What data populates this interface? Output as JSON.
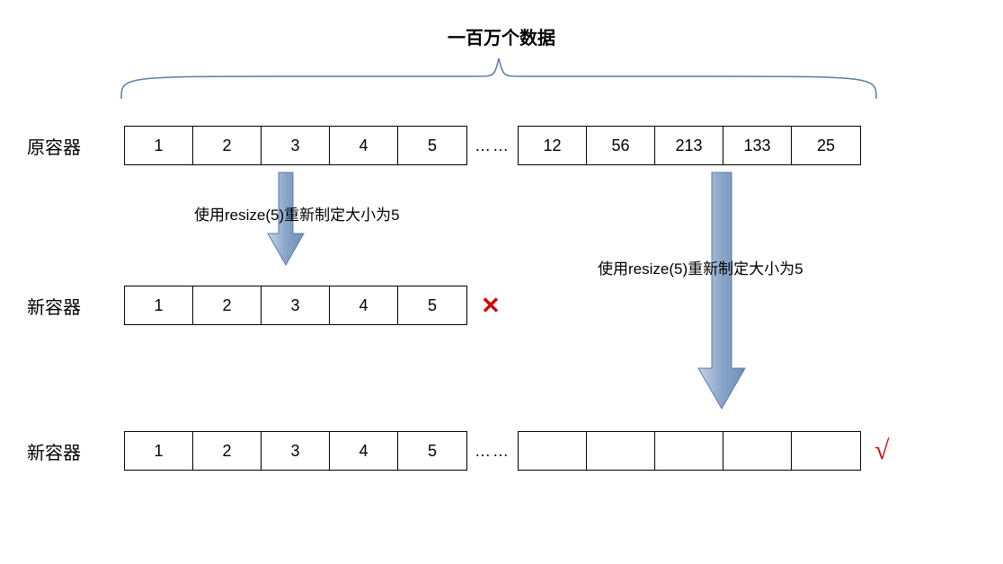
{
  "title": "一百万个数据",
  "labels": {
    "original": "原容器",
    "new": "新容器"
  },
  "rows": {
    "original_left": [
      "1",
      "2",
      "3",
      "4",
      "5"
    ],
    "original_right": [
      "12",
      "56",
      "213",
      "133",
      "25"
    ],
    "wrong_new": [
      "1",
      "2",
      "3",
      "4",
      "5"
    ],
    "correct_left": [
      "1",
      "2",
      "3",
      "4",
      "5"
    ],
    "correct_right": [
      "",
      "",
      "",
      "",
      ""
    ]
  },
  "ellipsis": "……",
  "arrow_text": "使用resize(5)重新制定大小为5",
  "marks": {
    "wrong": "✕",
    "correct": "√"
  }
}
